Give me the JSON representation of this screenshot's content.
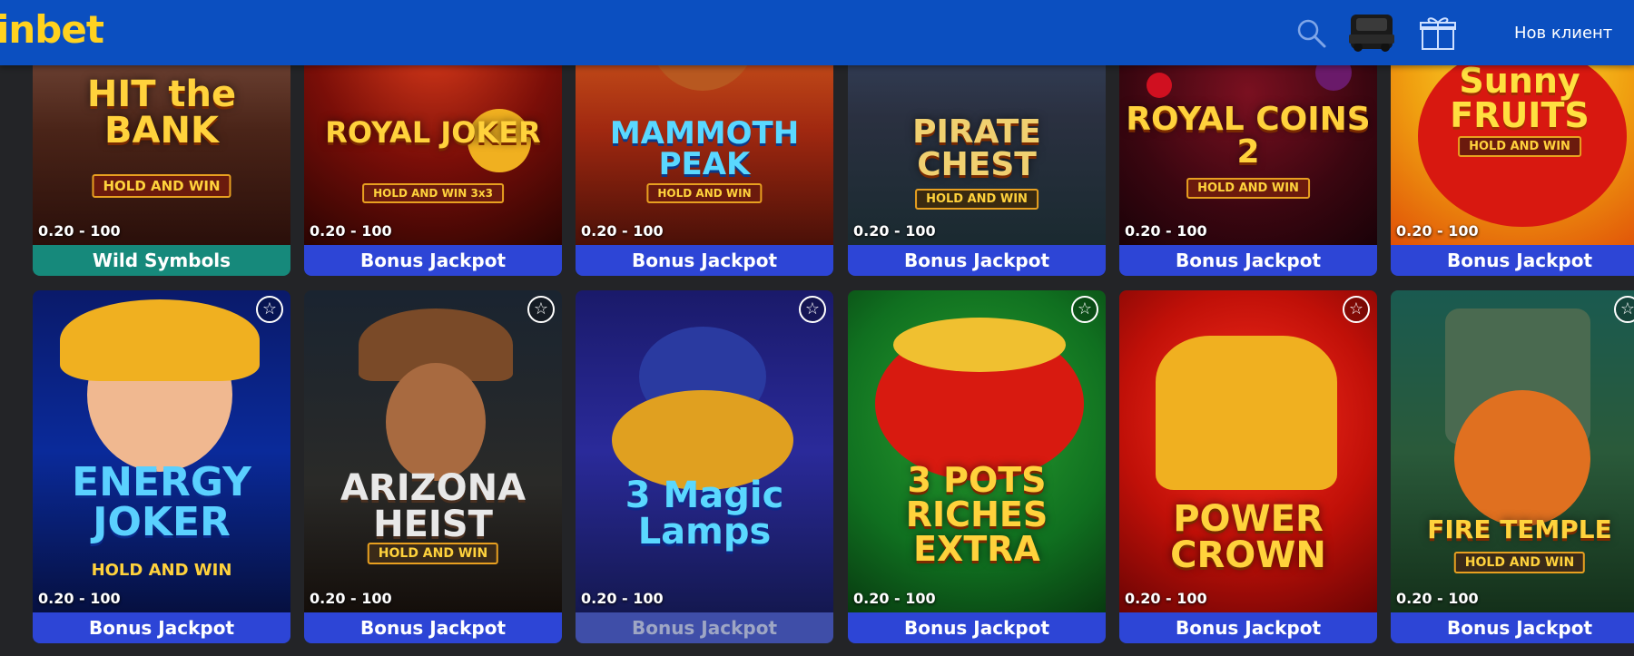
{
  "header": {
    "logo": "inbet",
    "new_client": "Нов клиент"
  },
  "icons": [
    "search-icon",
    "car-icon",
    "gift-icon",
    "star-icon"
  ],
  "colors": {
    "header_bg": "#0b4fc0",
    "logo": "#ffd21f",
    "label_bonus": "#2d45d6",
    "label_wild": "#16897b",
    "page_bg": "#232427"
  },
  "games_row1": [
    {
      "title": "HIT the BANK",
      "tag": "HOLD AND WIN",
      "bet": "0.20 - 100",
      "label": "Wild Symbols"
    },
    {
      "title": "ROYAL JOKER",
      "tag": "HOLD AND WIN 3x3",
      "bet": "0.20 - 100",
      "label": "Bonus Jackpot"
    },
    {
      "title": "MAMMOTH PEAK",
      "tag": "HOLD AND WIN",
      "bet": "0.20 - 100",
      "label": "Bonus Jackpot"
    },
    {
      "title": "PIRATE CHEST",
      "tag": "HOLD AND WIN",
      "bet": "0.20 - 100",
      "label": "Bonus Jackpot"
    },
    {
      "title": "ROYAL COINS 2",
      "tag": "HOLD AND WIN",
      "bet": "0.20 - 100",
      "label": "Bonus Jackpot"
    },
    {
      "title": "Sunny FRUITS",
      "tag": "HOLD AND WIN",
      "bet": "0.20 - 100",
      "label": "Bonus Jackpot"
    }
  ],
  "games_row2": [
    {
      "title": "ENERGY JOKER",
      "tag": "HOLD AND WIN",
      "bet": "0.20 - 100",
      "label": "Bonus Jackpot"
    },
    {
      "title": "ARIZONA HEIST",
      "tag": "HOLD AND WIN",
      "bet": "0.20 - 100",
      "label": "Bonus Jackpot"
    },
    {
      "title": "3 Magic Lamps",
      "tag": "",
      "bet": "0.20 - 100",
      "label": "Bonus Jackpot"
    },
    {
      "title": "3 POTS RICHES EXTRA",
      "tag": "",
      "bet": "0.20 - 100",
      "label": "Bonus Jackpot"
    },
    {
      "title": "POWER CROWN",
      "tag": "",
      "bet": "0.20 - 100",
      "label": "Bonus Jackpot"
    },
    {
      "title": "FIRE TEMPLE",
      "tag": "HOLD AND WIN",
      "bet": "0.20 - 100",
      "label": "Bonus Jackpot"
    }
  ]
}
